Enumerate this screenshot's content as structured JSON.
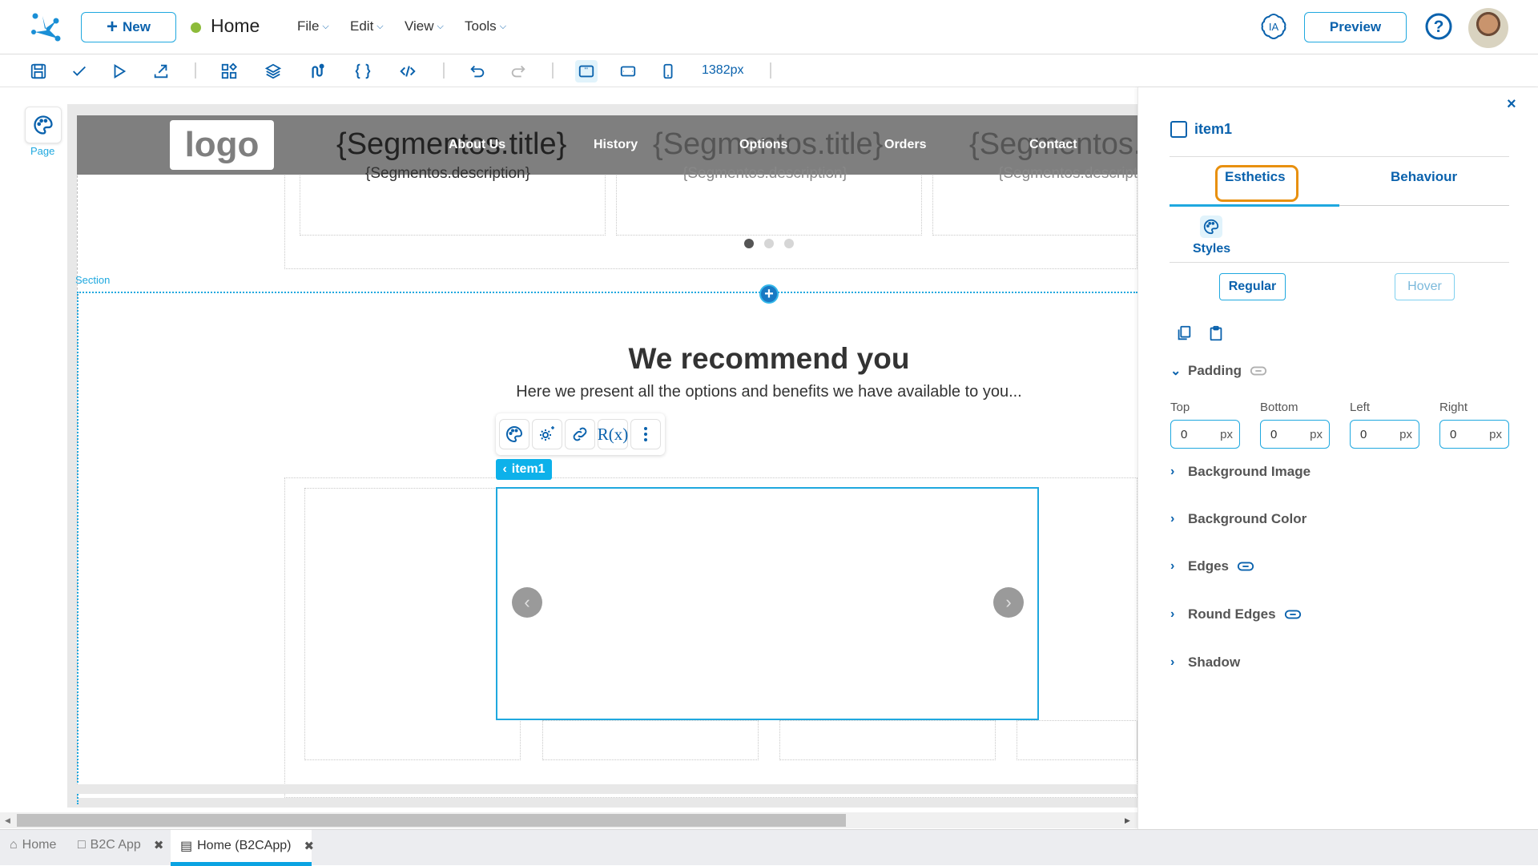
{
  "topbar": {
    "new_label": "New",
    "page_name": "Home",
    "page_status_color": "#8dbb3a",
    "menus": [
      "File",
      "Edit",
      "View",
      "Tools"
    ],
    "ia_label": "IA",
    "preview_label": "Preview"
  },
  "toolbar": {
    "icons": [
      "save-icon",
      "check-icon",
      "play-icon",
      "export-icon",
      "components-icon",
      "layers-icon",
      "flow-icon",
      "braces-icon",
      "code-icon",
      "undo-icon",
      "redo-icon",
      "desktop-view-icon",
      "tablet-view-icon",
      "mobile-view-icon"
    ],
    "width_label": "1382px"
  },
  "canvas": {
    "page_label": "Page",
    "logo_text": "logo",
    "nav": [
      "About Us",
      "History",
      "Options",
      "Orders",
      "Contact"
    ],
    "segment_title": "{Segmentos.title}",
    "segment_description": "{Segmentos.description}",
    "carousel_dots": 3,
    "carousel_active_dot": 1,
    "section_label": "Section",
    "recommend_title": "We recommend you",
    "recommend_subtitle": "Here we present all the options and benefits we have available to you...",
    "item_toolbar": [
      "palette-icon",
      "gear-sparkle-icon",
      "link-icon",
      "rx-icon",
      "more-vertical-icon"
    ],
    "rx_text": "R(x)",
    "item_tag": "item1"
  },
  "panel": {
    "title": "item1",
    "tabs": [
      "Esthetics",
      "Behaviour"
    ],
    "active_tab": "Esthetics",
    "styles_label": "Styles",
    "state_buttons": [
      "Regular",
      "Hover"
    ],
    "padding": {
      "label": "Padding",
      "fields": [
        {
          "label": "Top",
          "value": "0",
          "unit": "px"
        },
        {
          "label": "Bottom",
          "value": "0",
          "unit": "px"
        },
        {
          "label": "Left",
          "value": "0",
          "unit": "px"
        },
        {
          "label": "Right",
          "value": "0",
          "unit": "px"
        }
      ]
    },
    "sections": [
      "Background Image",
      "Background Color",
      "Edges",
      "Round Edges",
      "Shadow"
    ]
  },
  "bottom_tabs": [
    {
      "label": "Home",
      "icon": "home-icon",
      "closable": false
    },
    {
      "label": "B2C App",
      "icon": "folder-icon",
      "closable": true
    },
    {
      "label": "Home (B2CApp)",
      "icon": "page-icon",
      "closable": true,
      "active": true
    }
  ],
  "colors": {
    "brand": "#0a62ad",
    "accent": "#1fa8df",
    "highlight": "#e8900f"
  }
}
